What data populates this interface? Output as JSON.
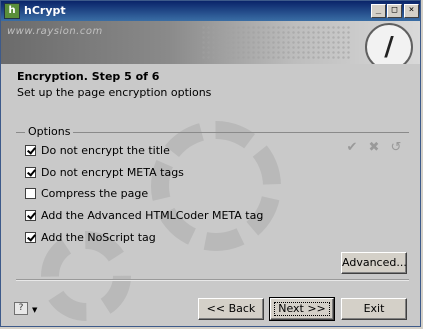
{
  "window": {
    "title": "hCrypt",
    "icon": "hcrypt-app-icon",
    "minimize": "_",
    "maximize": "□",
    "close": "×"
  },
  "banner": {
    "site": "www.raysion.com",
    "logo_glyph": "/"
  },
  "header": {
    "title": "Encryption. Step 5 of 6",
    "subtitle": "Set up the page encryption options"
  },
  "options": {
    "group_label": "Options",
    "items": [
      {
        "label": "Do not encrypt the title",
        "checked": true
      },
      {
        "label": "Do not encrypt META tags",
        "checked": true
      },
      {
        "label": "Compress the page",
        "checked": false
      },
      {
        "label": "Add the Advanced HTMLCoder META tag",
        "checked": true
      },
      {
        "label": "Add the NoScript tag",
        "checked": true
      }
    ],
    "side_icons": [
      "check-icon",
      "cross-tools-icon",
      "reset-icon"
    ]
  },
  "buttons": {
    "advanced": "Advanced...",
    "back": "<< Back",
    "next": "Next >>",
    "exit": "Exit"
  },
  "footer": {
    "help_icon": "help-icon",
    "help_glyph": "?"
  }
}
